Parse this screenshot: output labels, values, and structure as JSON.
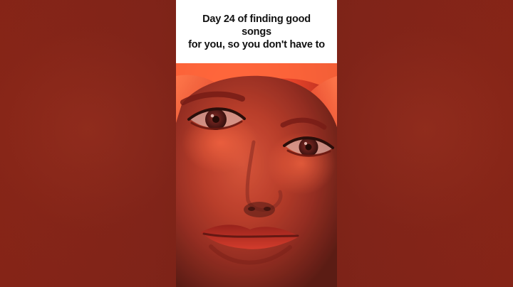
{
  "caption": {
    "text": "Day 24 of finding good songs\nfor you, so you don't have to"
  },
  "colors": {
    "background": "#84251a",
    "caption_background": "#ffffff",
    "caption_text": "#111111",
    "video_tone": "#ff5d33"
  },
  "video": {
    "subject": "close-up face in red lighting"
  }
}
